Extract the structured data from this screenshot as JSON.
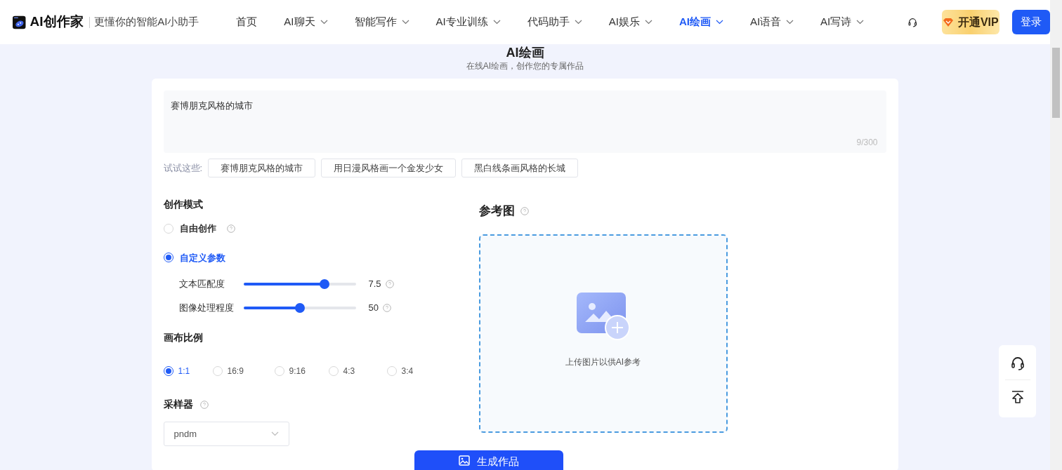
{
  "header": {
    "logo_text": "AI创作家",
    "tagline": "更懂你的智能AI小助手",
    "nav": [
      {
        "label": "首页",
        "selected": false,
        "dropdown": false
      },
      {
        "label": "AI聊天",
        "selected": false,
        "dropdown": true
      },
      {
        "label": "智能写作",
        "selected": false,
        "dropdown": true
      },
      {
        "label": "AI专业训练",
        "selected": false,
        "dropdown": true
      },
      {
        "label": "代码助手",
        "selected": false,
        "dropdown": true
      },
      {
        "label": "AI娱乐",
        "selected": false,
        "dropdown": true
      },
      {
        "label": "AI绘画",
        "selected": true,
        "dropdown": true
      },
      {
        "label": "AI语音",
        "selected": false,
        "dropdown": true
      },
      {
        "label": "AI写诗",
        "selected": false,
        "dropdown": true
      }
    ],
    "vip_button": "开通VIP",
    "login_button": "登录"
  },
  "page": {
    "title": "AI绘画",
    "subtitle": "在线AI绘画，创作您的专属作品"
  },
  "prompt": {
    "value": "赛博朋克风格的城市",
    "counter": "9/300"
  },
  "suggestions": {
    "label": "试试这些:",
    "items": [
      "赛博朋克风格的城市",
      "用日漫风格画一个金发少女",
      "黑白线条画风格的长城"
    ]
  },
  "mode": {
    "title": "创作模式",
    "options": [
      {
        "label": "自由创作",
        "selected": false,
        "help": true
      },
      {
        "label": "自定义参数",
        "selected": true,
        "help": false
      }
    ],
    "sliders": [
      {
        "label": "文本匹配度",
        "level": 0.72,
        "reading": "7.5"
      },
      {
        "label": "图像处理程度",
        "level": 0.5,
        "reading": "50"
      }
    ]
  },
  "ratio": {
    "title": "画布比例",
    "options": [
      {
        "label": "1:1",
        "selected": true
      },
      {
        "label": "16:9",
        "selected": false
      },
      {
        "label": "9:16",
        "selected": false
      },
      {
        "label": "4:3",
        "selected": false
      },
      {
        "label": "3:4",
        "selected": false
      }
    ]
  },
  "sampler": {
    "title": "采样器",
    "value": "pndm"
  },
  "reference": {
    "title": "参考图",
    "upload_hint": "上传图片以供AI参考"
  },
  "generate_button": "生成作品"
}
